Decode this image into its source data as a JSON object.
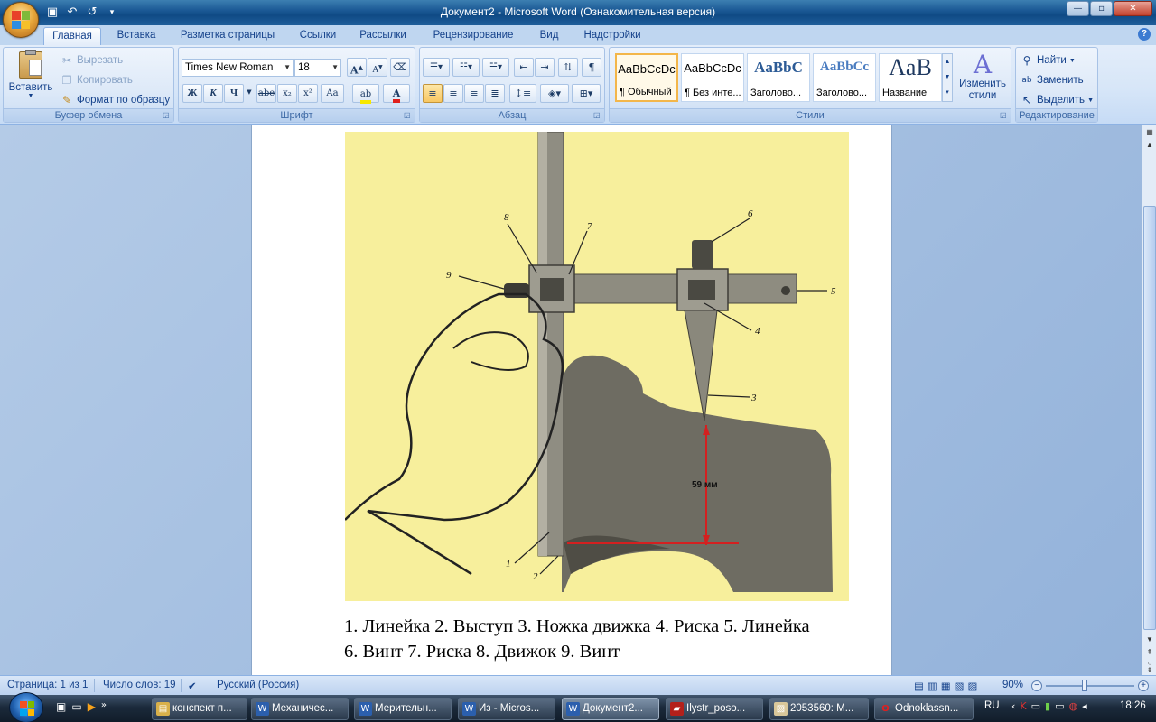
{
  "window": {
    "title": "Документ2 - Microsoft Word (Ознакомительная версия)",
    "controls": {
      "minimize": "—",
      "maximize": "▫",
      "close": "✕"
    }
  },
  "qat": {
    "save_icon": "save-icon",
    "undo_icon": "undo-icon",
    "redo_icon": "redo-icon",
    "customize_icon": "customize-icon"
  },
  "tabs": [
    "Главная",
    "Вставка",
    "Разметка страницы",
    "Ссылки",
    "Рассылки",
    "Рецензирование",
    "Вид",
    "Надстройки"
  ],
  "ribbon": {
    "clipboard": {
      "label": "Буфер обмена",
      "paste": "Вставить",
      "cut": "Вырезать",
      "copy": "Копировать",
      "format_painter": "Формат по образцу"
    },
    "font": {
      "label": "Шрифт",
      "font_name": "Times New Roman",
      "font_size": "18",
      "bold": "Ж",
      "italic": "К",
      "underline": "Ч",
      "strike": "abe",
      "subscript": "x₂",
      "superscript": "x²",
      "case": "Aa",
      "grow": "A",
      "shrink": "A"
    },
    "paragraph": {
      "label": "Абзац"
    },
    "styles": {
      "label": "Стили",
      "items": [
        {
          "sample": "AaBbCcDc",
          "name": "¶ Обычный"
        },
        {
          "sample": "AaBbCcDc",
          "name": "¶ Без инте..."
        },
        {
          "sample": "AaBbC",
          "name": "Заголово..."
        },
        {
          "sample": "AaBbCc",
          "name": "Заголово..."
        },
        {
          "sample": "AaB",
          "name": "Название"
        }
      ],
      "change_styles": "Изменить стили"
    },
    "editing": {
      "label": "Редактирование",
      "find": "Найти",
      "replace": "Заменить",
      "select": "Выделить"
    }
  },
  "figure": {
    "labels": [
      "1",
      "2",
      "3",
      "4",
      "5",
      "6",
      "7",
      "8",
      "9"
    ],
    "measure": "59 мм"
  },
  "caption": {
    "line1": "1. Линейка 2. Выступ 3. Ножка движка 4. Риска 5. Линейка",
    "line2": "6. Винт 7. Риска 8. Движок 9. Винт"
  },
  "statusbar": {
    "page": "Страница: 1 из 1",
    "words": "Число слов: 19",
    "language": "Русский (Россия)",
    "zoom": "90%"
  },
  "taskbar": {
    "items": [
      {
        "label": "конспект п...",
        "icon": "folder-icon"
      },
      {
        "label": "Механичес...",
        "icon": "word-icon"
      },
      {
        "label": "Мерительн...",
        "icon": "word-icon"
      },
      {
        "label": "Из - Micros...",
        "icon": "word-icon"
      },
      {
        "label": "Документ2...",
        "icon": "word-icon"
      },
      {
        "label": "Ilystr_poso...",
        "icon": "pdf-icon"
      },
      {
        "label": "2053560: M...",
        "icon": "image-icon"
      },
      {
        "label": "Odnoklassn...",
        "icon": "opera-icon"
      }
    ],
    "lang": "RU",
    "time": "18:26"
  }
}
